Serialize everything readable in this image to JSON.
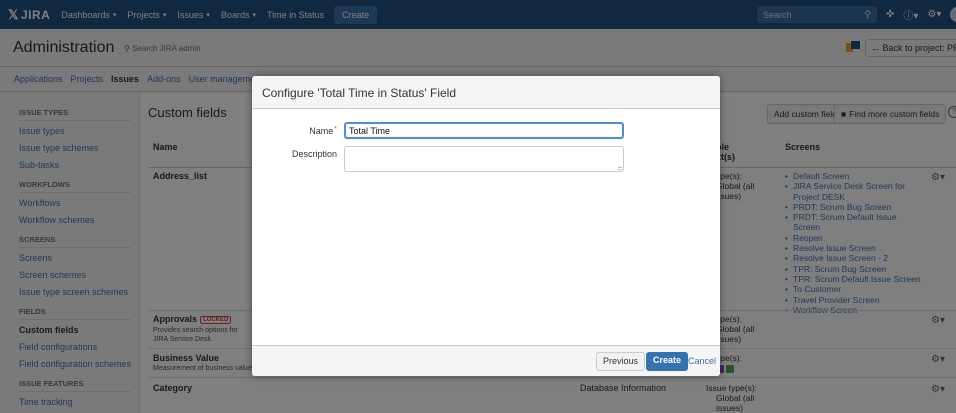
{
  "topnav": {
    "logo": "JIRA",
    "items": [
      {
        "label": "Dashboards",
        "dropdown": true
      },
      {
        "label": "Projects",
        "dropdown": true
      },
      {
        "label": "Issues",
        "dropdown": true
      },
      {
        "label": "Boards",
        "dropdown": true
      },
      {
        "label": "Time in Status",
        "dropdown": false
      }
    ],
    "create_label": "Create",
    "search_placeholder": "Search",
    "icons": [
      "search-icon",
      "feedback-icon",
      "help-icon",
      "settings-icon",
      "avatar"
    ]
  },
  "admin_header": {
    "title": "Administration",
    "search_label": "Search JIRA admin",
    "back_label": "← Back to project: PRDT"
  },
  "admin_tabs": [
    {
      "label": "Applications",
      "active": false
    },
    {
      "label": "Projects",
      "active": false
    },
    {
      "label": "Issues",
      "active": true
    },
    {
      "label": "Add-ons",
      "active": false
    },
    {
      "label": "User management",
      "active": false
    }
  ],
  "sidebar": {
    "sections": [
      {
        "heading": "ISSUE TYPES",
        "links": [
          "Issue types",
          "Issue type schemes",
          "Sub-tasks"
        ]
      },
      {
        "heading": "WORKFLOWS",
        "links": [
          "Workflows",
          "Workflow schemes"
        ]
      },
      {
        "heading": "SCREENS",
        "links": [
          "Screens",
          "Screen schemes",
          "Issue type screen schemes"
        ]
      },
      {
        "heading": "FIELDS",
        "links": [
          "Custom fields",
          "Field configurations",
          "Field configuration schemes"
        ]
      },
      {
        "heading": "ISSUE FEATURES",
        "links": [
          "Time tracking"
        ]
      }
    ],
    "active_link": "Custom fields"
  },
  "main": {
    "title": "Custom fields",
    "add_button": "Add custom field",
    "find_button": "Find more custom fields",
    "columns": {
      "name": "Name",
      "context_a": "ble",
      "context_b": "xt(s)",
      "screens": "Screens"
    },
    "rows": [
      {
        "name": "Address_list",
        "context": [
          "ype(s):",
          "Global (all",
          "ssues)"
        ],
        "screens": [
          "Default Screen",
          "JIRA Service Desk Screen for Project DESK",
          "PRDT: Scrum Bug Screen",
          "PRDT: Scrum Default Issue Screen",
          "Reopen",
          "Resolve Issue Screen",
          "Resolve Issue Screen - 2",
          "TPR: Scrum Bug Screen",
          "TPR: Scrum Default Issue Screen",
          "To Customer",
          "Travel Provider Screen",
          "Workflow Screen"
        ]
      },
      {
        "name": "Approvals",
        "badge": "LOCKED",
        "description": "Provides search options for JIRA Service Desk.",
        "context": [
          "ype(s):",
          "Global (all",
          "ssues)"
        ]
      },
      {
        "name": "Business Value",
        "description": "Measurement of business value",
        "context": [
          "ype(s):"
        ]
      },
      {
        "name": "Category",
        "type": "Database Information",
        "context": [
          "Issue type(s):",
          "Global (all",
          "issues)"
        ]
      }
    ]
  },
  "dialog": {
    "title": "Configure 'Total Time in Status' Field",
    "name_label": "Name",
    "required_mark": "*",
    "name_value": "Total Time",
    "description_label": "Description",
    "description_value": "",
    "previous_label": "Previous",
    "create_label": "Create",
    "cancel_label": "Cancel"
  }
}
